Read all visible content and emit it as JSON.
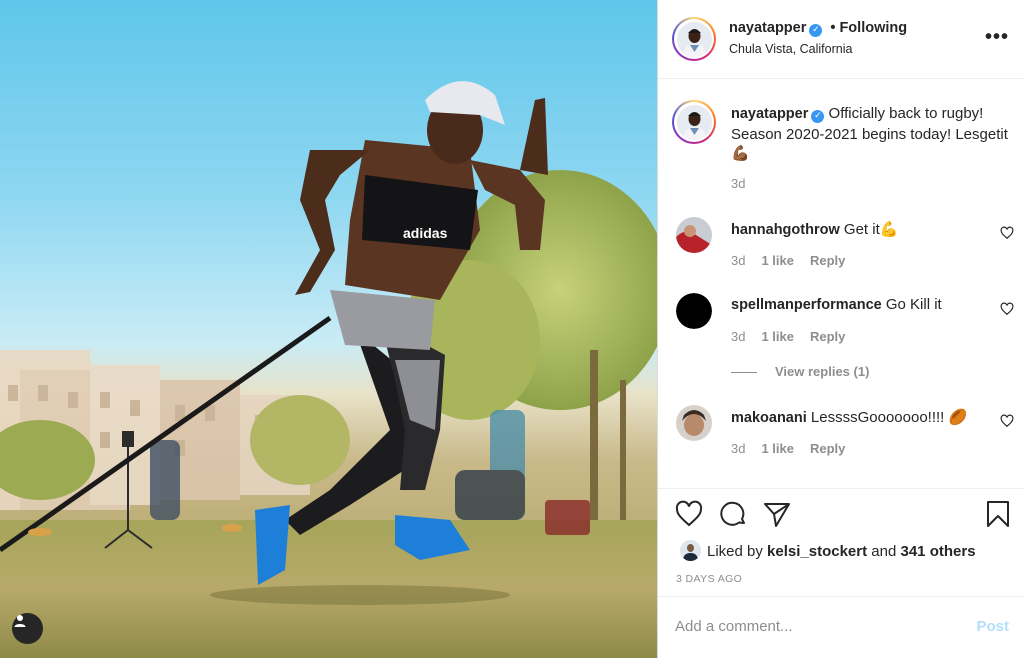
{
  "post": {
    "author": "nayatapper",
    "follow_separator": "•",
    "follow_label": "Following",
    "location": "Chula Vista, California",
    "more_label": "•••",
    "caption": "Officially back to rugby! Season 2020-2021 begins today! Lesgetit💪🏾",
    "caption_time": "3d",
    "logo_text": "adidas"
  },
  "comments": [
    {
      "user": "hannahgothrow",
      "text": "Get it💪",
      "time": "3d",
      "likes": "1 like",
      "reply": "Reply"
    },
    {
      "user": "spellmanperformance",
      "text": "Go Kill it",
      "time": "3d",
      "likes": "1 like",
      "reply": "Reply"
    },
    {
      "user": "makoanani",
      "text": "LessssGooooooo!!!! 🏉",
      "time": "3d",
      "likes": "1 like",
      "reply": "Reply"
    }
  ],
  "view_replies": "View replies (1)",
  "likes": {
    "prefix": "Liked by",
    "user": "kelsi_stockert",
    "joiner": "and",
    "others": "341 others"
  },
  "post_time": "3 DAYS AGO",
  "comment_input": {
    "placeholder": "Add a comment...",
    "post_label": "Post"
  },
  "colors": {
    "accent": "#0095f6",
    "post_disabled": "#b2dffc",
    "verified": "#3897f0"
  },
  "icons": [
    "heart-icon",
    "comment-icon",
    "share-icon",
    "bookmark-icon",
    "more-icon",
    "user-tag-icon",
    "verified-icon"
  ]
}
